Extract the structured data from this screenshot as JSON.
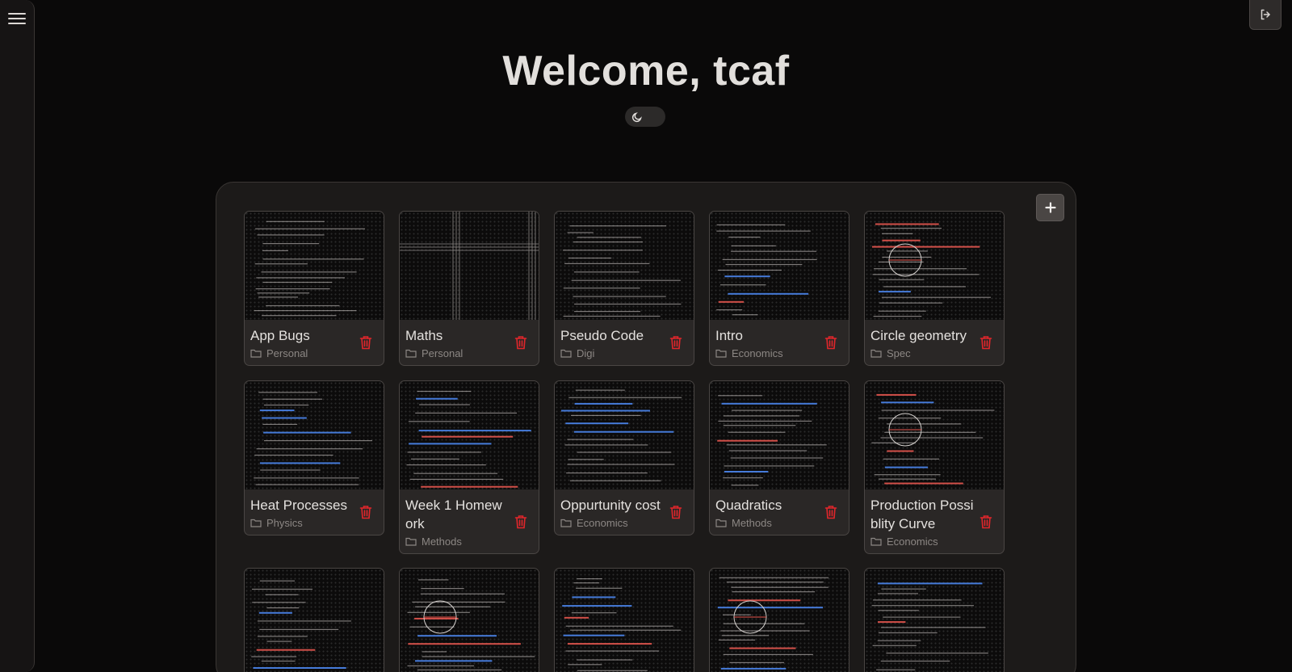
{
  "header": {
    "title": "Welcome, tcaf",
    "menu_icon": "hamburger-menu-icon",
    "logout_icon": "logout-icon",
    "theme_icon": "moon-icon"
  },
  "panel": {
    "add_icon": "plus-icon"
  },
  "colors": {
    "delete": "#e0262b",
    "handwriting_blue": "#4b86f0",
    "handwriting_red": "#e8574f"
  },
  "notes": [
    {
      "title": "App Bugs",
      "folder": "Personal",
      "thumb": "text"
    },
    {
      "title": "Maths",
      "folder": "Personal",
      "thumb": "grid"
    },
    {
      "title": "Pseudo Code",
      "folder": "Digi",
      "thumb": "text"
    },
    {
      "title": "Intro",
      "folder": "Economics",
      "thumb": "handwriting"
    },
    {
      "title": "Circle geometry",
      "folder": "Spec",
      "thumb": "diagram"
    },
    {
      "title": "Heat Processes",
      "folder": "Physics",
      "thumb": "handwriting"
    },
    {
      "title": "Week 1 Homework",
      "folder": "Methods",
      "thumb": "handwriting"
    },
    {
      "title": "Oppurtunity cost",
      "folder": "Economics",
      "thumb": "handwriting"
    },
    {
      "title": "Quadratics",
      "folder": "Methods",
      "thumb": "handwriting"
    },
    {
      "title": "Production Possiblity Curve",
      "folder": "Economics",
      "thumb": "diagram"
    },
    {
      "title": "",
      "folder": "",
      "thumb": "handwriting"
    },
    {
      "title": "",
      "folder": "",
      "thumb": "diagram"
    },
    {
      "title": "",
      "folder": "",
      "thumb": "handwriting"
    },
    {
      "title": "",
      "folder": "",
      "thumb": "diagram"
    },
    {
      "title": "",
      "folder": "",
      "thumb": "handwriting"
    }
  ]
}
